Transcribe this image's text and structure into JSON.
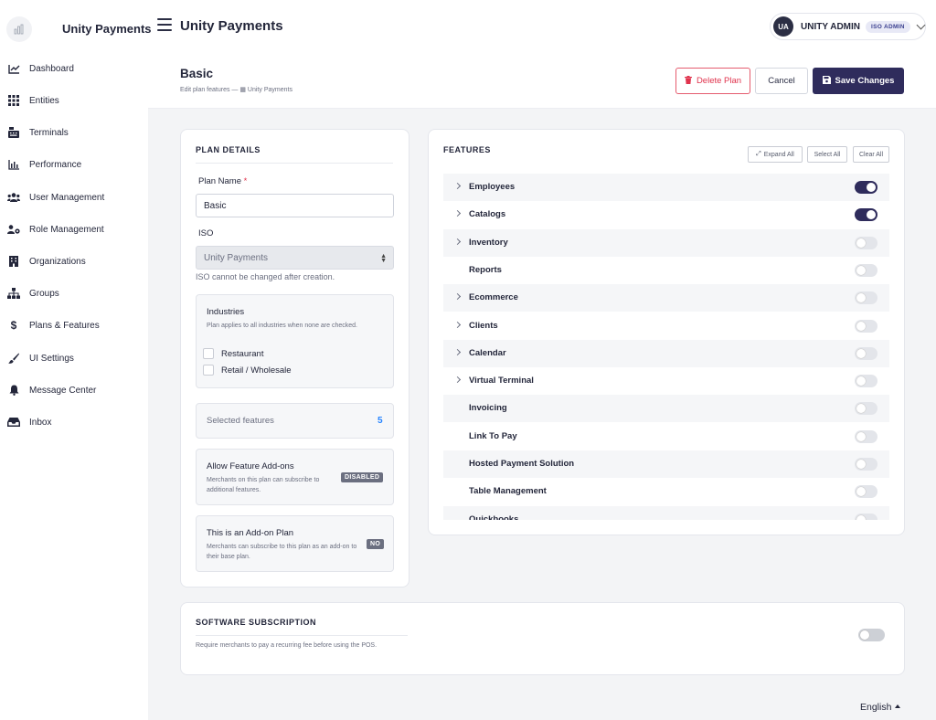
{
  "topbar": {
    "brand": "Unity Payments",
    "app_title": "Unity Payments",
    "user": {
      "initials": "UA",
      "name": "UNITY ADMIN",
      "role_badge": "ISO ADMIN"
    }
  },
  "sidebar": {
    "items": [
      {
        "label": "Dashboard",
        "icon": "chart-line-icon"
      },
      {
        "label": "Entities",
        "icon": "grid-icon"
      },
      {
        "label": "Terminals",
        "icon": "cash-register-icon"
      },
      {
        "label": "Performance",
        "icon": "bar-chart-icon"
      },
      {
        "label": "User Management",
        "icon": "users-icon"
      },
      {
        "label": "Role Management",
        "icon": "users-cog-icon"
      },
      {
        "label": "Organizations",
        "icon": "building-icon"
      },
      {
        "label": "Groups",
        "icon": "sitemap-icon"
      },
      {
        "label": "Plans & Features",
        "icon": "dollar-icon"
      },
      {
        "label": "UI Settings",
        "icon": "brush-icon"
      },
      {
        "label": "Message Center",
        "icon": "bell-icon"
      },
      {
        "label": "Inbox",
        "icon": "inbox-icon"
      }
    ]
  },
  "header": {
    "title": "Basic",
    "subtitle": "Edit plan features — ▦ Unity Payments",
    "delete_label": "Delete Plan",
    "cancel_label": "Cancel",
    "save_label": "Save Changes"
  },
  "plan_details": {
    "section_title": "PLAN DETAILS",
    "plan_name_label": "Plan Name",
    "required_mark": "*",
    "plan_name_value": "Basic",
    "iso_label": "ISO",
    "iso_value": "Unity Payments",
    "iso_hint": "ISO cannot be changed after creation.",
    "industries": {
      "title": "Industries",
      "description": "Plan applies to all industries when none are checked.",
      "options": [
        {
          "label": "Restaurant",
          "checked": false
        },
        {
          "label": "Retail / Wholesale",
          "checked": false
        }
      ]
    },
    "selected_features": {
      "label": "Selected features",
      "count": "5"
    },
    "feature_addons": {
      "title": "Allow Feature Add-ons",
      "description": "Merchants on this plan can subscribe to additional features.",
      "status": "DISABLED"
    },
    "addon_plan": {
      "title": "This is an Add-on Plan",
      "description": "Merchants can subscribe to this plan as an add-on to their base plan.",
      "status": "NO"
    }
  },
  "features": {
    "section_title": "FEATURES",
    "expand_all_label": "Expand All",
    "select_all_label": "Select All",
    "clear_all_label": "Clear All",
    "items": [
      {
        "name": "Employees",
        "expandable": true,
        "enabled": true
      },
      {
        "name": "Catalogs",
        "expandable": true,
        "enabled": true
      },
      {
        "name": "Inventory",
        "expandable": true,
        "enabled": false
      },
      {
        "name": "Reports",
        "expandable": false,
        "enabled": false
      },
      {
        "name": "Ecommerce",
        "expandable": true,
        "enabled": false
      },
      {
        "name": "Clients",
        "expandable": true,
        "enabled": false
      },
      {
        "name": "Calendar",
        "expandable": true,
        "enabled": false
      },
      {
        "name": "Virtual Terminal",
        "expandable": true,
        "enabled": false
      },
      {
        "name": "Invoicing",
        "expandable": false,
        "enabled": false
      },
      {
        "name": "Link To Pay",
        "expandable": false,
        "enabled": false
      },
      {
        "name": "Hosted Payment Solution",
        "expandable": false,
        "enabled": false
      },
      {
        "name": "Table Management",
        "expandable": false,
        "enabled": false
      },
      {
        "name": "Quickbooks",
        "expandable": false,
        "enabled": false
      }
    ]
  },
  "software_subscription": {
    "section_title": "SOFTWARE SUBSCRIPTION",
    "description": "Require merchants to pay a recurring fee before using the POS.",
    "enabled": false
  },
  "footer": {
    "language": "English"
  },
  "colors": {
    "primary": "#2f2c5c",
    "danger": "#e0334d",
    "accent_blue": "#2684ff",
    "background": "#f3f4f6"
  }
}
